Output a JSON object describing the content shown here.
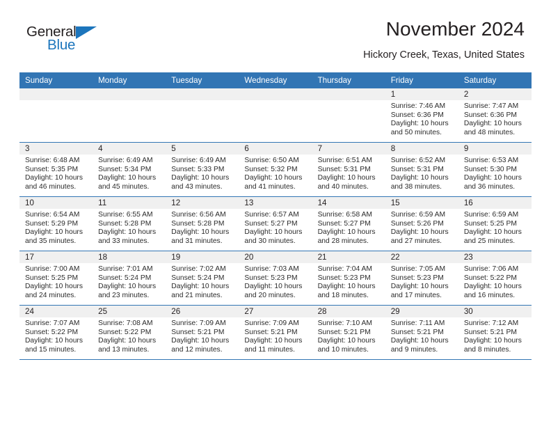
{
  "brand": {
    "word_general": "General",
    "word_blue": "Blue",
    "triangle_color": "#1c75bc"
  },
  "header": {
    "title": "November 2024",
    "subtitle": "Hickory Creek, Texas, United States"
  },
  "theme": {
    "header_blue": "#3275b4",
    "daynum_band": "#f0f0f0",
    "text": "#231f20"
  },
  "calendar": {
    "weekday_headers": [
      "Sunday",
      "Monday",
      "Tuesday",
      "Wednesday",
      "Thursday",
      "Friday",
      "Saturday"
    ],
    "labels": {
      "sunrise": "Sunrise:",
      "sunset": "Sunset:",
      "daylight": "Daylight:"
    },
    "weeks": [
      [
        {
          "day": "",
          "sunrise": "",
          "sunset": "",
          "daylight": "",
          "empty": true
        },
        {
          "day": "",
          "sunrise": "",
          "sunset": "",
          "daylight": "",
          "empty": true
        },
        {
          "day": "",
          "sunrise": "",
          "sunset": "",
          "daylight": "",
          "empty": true
        },
        {
          "day": "",
          "sunrise": "",
          "sunset": "",
          "daylight": "",
          "empty": true
        },
        {
          "day": "",
          "sunrise": "",
          "sunset": "",
          "daylight": "",
          "empty": true
        },
        {
          "day": "1",
          "sunrise": "Sunrise: 7:46 AM",
          "sunset": "Sunset: 6:36 PM",
          "daylight": "Daylight: 10 hours and 50 minutes.",
          "empty": false
        },
        {
          "day": "2",
          "sunrise": "Sunrise: 7:47 AM",
          "sunset": "Sunset: 6:36 PM",
          "daylight": "Daylight: 10 hours and 48 minutes.",
          "empty": false
        }
      ],
      [
        {
          "day": "3",
          "sunrise": "Sunrise: 6:48 AM",
          "sunset": "Sunset: 5:35 PM",
          "daylight": "Daylight: 10 hours and 46 minutes.",
          "empty": false
        },
        {
          "day": "4",
          "sunrise": "Sunrise: 6:49 AM",
          "sunset": "Sunset: 5:34 PM",
          "daylight": "Daylight: 10 hours and 45 minutes.",
          "empty": false
        },
        {
          "day": "5",
          "sunrise": "Sunrise: 6:49 AM",
          "sunset": "Sunset: 5:33 PM",
          "daylight": "Daylight: 10 hours and 43 minutes.",
          "empty": false
        },
        {
          "day": "6",
          "sunrise": "Sunrise: 6:50 AM",
          "sunset": "Sunset: 5:32 PM",
          "daylight": "Daylight: 10 hours and 41 minutes.",
          "empty": false
        },
        {
          "day": "7",
          "sunrise": "Sunrise: 6:51 AM",
          "sunset": "Sunset: 5:31 PM",
          "daylight": "Daylight: 10 hours and 40 minutes.",
          "empty": false
        },
        {
          "day": "8",
          "sunrise": "Sunrise: 6:52 AM",
          "sunset": "Sunset: 5:31 PM",
          "daylight": "Daylight: 10 hours and 38 minutes.",
          "empty": false
        },
        {
          "day": "9",
          "sunrise": "Sunrise: 6:53 AM",
          "sunset": "Sunset: 5:30 PM",
          "daylight": "Daylight: 10 hours and 36 minutes.",
          "empty": false
        }
      ],
      [
        {
          "day": "10",
          "sunrise": "Sunrise: 6:54 AM",
          "sunset": "Sunset: 5:29 PM",
          "daylight": "Daylight: 10 hours and 35 minutes.",
          "empty": false
        },
        {
          "day": "11",
          "sunrise": "Sunrise: 6:55 AM",
          "sunset": "Sunset: 5:28 PM",
          "daylight": "Daylight: 10 hours and 33 minutes.",
          "empty": false
        },
        {
          "day": "12",
          "sunrise": "Sunrise: 6:56 AM",
          "sunset": "Sunset: 5:28 PM",
          "daylight": "Daylight: 10 hours and 31 minutes.",
          "empty": false
        },
        {
          "day": "13",
          "sunrise": "Sunrise: 6:57 AM",
          "sunset": "Sunset: 5:27 PM",
          "daylight": "Daylight: 10 hours and 30 minutes.",
          "empty": false
        },
        {
          "day": "14",
          "sunrise": "Sunrise: 6:58 AM",
          "sunset": "Sunset: 5:27 PM",
          "daylight": "Daylight: 10 hours and 28 minutes.",
          "empty": false
        },
        {
          "day": "15",
          "sunrise": "Sunrise: 6:59 AM",
          "sunset": "Sunset: 5:26 PM",
          "daylight": "Daylight: 10 hours and 27 minutes.",
          "empty": false
        },
        {
          "day": "16",
          "sunrise": "Sunrise: 6:59 AM",
          "sunset": "Sunset: 5:25 PM",
          "daylight": "Daylight: 10 hours and 25 minutes.",
          "empty": false
        }
      ],
      [
        {
          "day": "17",
          "sunrise": "Sunrise: 7:00 AM",
          "sunset": "Sunset: 5:25 PM",
          "daylight": "Daylight: 10 hours and 24 minutes.",
          "empty": false
        },
        {
          "day": "18",
          "sunrise": "Sunrise: 7:01 AM",
          "sunset": "Sunset: 5:24 PM",
          "daylight": "Daylight: 10 hours and 23 minutes.",
          "empty": false
        },
        {
          "day": "19",
          "sunrise": "Sunrise: 7:02 AM",
          "sunset": "Sunset: 5:24 PM",
          "daylight": "Daylight: 10 hours and 21 minutes.",
          "empty": false
        },
        {
          "day": "20",
          "sunrise": "Sunrise: 7:03 AM",
          "sunset": "Sunset: 5:23 PM",
          "daylight": "Daylight: 10 hours and 20 minutes.",
          "empty": false
        },
        {
          "day": "21",
          "sunrise": "Sunrise: 7:04 AM",
          "sunset": "Sunset: 5:23 PM",
          "daylight": "Daylight: 10 hours and 18 minutes.",
          "empty": false
        },
        {
          "day": "22",
          "sunrise": "Sunrise: 7:05 AM",
          "sunset": "Sunset: 5:23 PM",
          "daylight": "Daylight: 10 hours and 17 minutes.",
          "empty": false
        },
        {
          "day": "23",
          "sunrise": "Sunrise: 7:06 AM",
          "sunset": "Sunset: 5:22 PM",
          "daylight": "Daylight: 10 hours and 16 minutes.",
          "empty": false
        }
      ],
      [
        {
          "day": "24",
          "sunrise": "Sunrise: 7:07 AM",
          "sunset": "Sunset: 5:22 PM",
          "daylight": "Daylight: 10 hours and 15 minutes.",
          "empty": false
        },
        {
          "day": "25",
          "sunrise": "Sunrise: 7:08 AM",
          "sunset": "Sunset: 5:22 PM",
          "daylight": "Daylight: 10 hours and 13 minutes.",
          "empty": false
        },
        {
          "day": "26",
          "sunrise": "Sunrise: 7:09 AM",
          "sunset": "Sunset: 5:21 PM",
          "daylight": "Daylight: 10 hours and 12 minutes.",
          "empty": false
        },
        {
          "day": "27",
          "sunrise": "Sunrise: 7:09 AM",
          "sunset": "Sunset: 5:21 PM",
          "daylight": "Daylight: 10 hours and 11 minutes.",
          "empty": false
        },
        {
          "day": "28",
          "sunrise": "Sunrise: 7:10 AM",
          "sunset": "Sunset: 5:21 PM",
          "daylight": "Daylight: 10 hours and 10 minutes.",
          "empty": false
        },
        {
          "day": "29",
          "sunrise": "Sunrise: 7:11 AM",
          "sunset": "Sunset: 5:21 PM",
          "daylight": "Daylight: 10 hours and 9 minutes.",
          "empty": false
        },
        {
          "day": "30",
          "sunrise": "Sunrise: 7:12 AM",
          "sunset": "Sunset: 5:21 PM",
          "daylight": "Daylight: 10 hours and 8 minutes.",
          "empty": false
        }
      ]
    ]
  }
}
